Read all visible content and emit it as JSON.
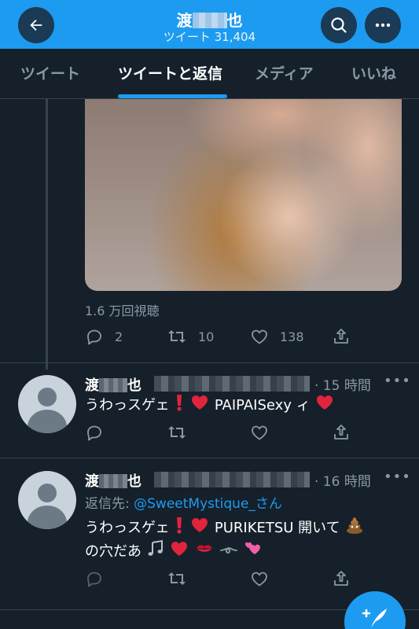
{
  "header": {
    "name_prefix": "渡",
    "name_suffix": "也",
    "tweet_count": "ツイート 31,404",
    "back_icon": "arrow-left-icon",
    "search_icon": "search-icon",
    "more_icon": "more-icon"
  },
  "tabs": [
    {
      "label": "ツイート",
      "active": false
    },
    {
      "label": "ツイートと返信",
      "active": true
    },
    {
      "label": "メディア",
      "active": false
    },
    {
      "label": "いいね",
      "active": false
    }
  ],
  "media_tweet": {
    "views": "1.6 万回視聴",
    "reply_count": "2",
    "retweet_count": "10",
    "like_count": "138"
  },
  "tweets": [
    {
      "name_prefix": "渡",
      "name_suffix": "也",
      "time": "· 15 時間",
      "more": "•••",
      "text_1": "うわっスゲェ",
      "text_2": "PAIPAISexy ィ"
    },
    {
      "name_prefix": "渡",
      "name_suffix": "也",
      "time": "· 16 時間",
      "more": "•••",
      "reply_label": "返信先: ",
      "reply_handle": "@SweetMystique_さん",
      "text_1": "うわっスゲェ",
      "text_2": "PURIKETSU 開いて",
      "text_3": "の穴だあ"
    }
  ],
  "colors": {
    "background": "#15202b",
    "accent": "#1d9bf0",
    "secondary_text": "#8b98a5",
    "divider": "#38444d"
  }
}
